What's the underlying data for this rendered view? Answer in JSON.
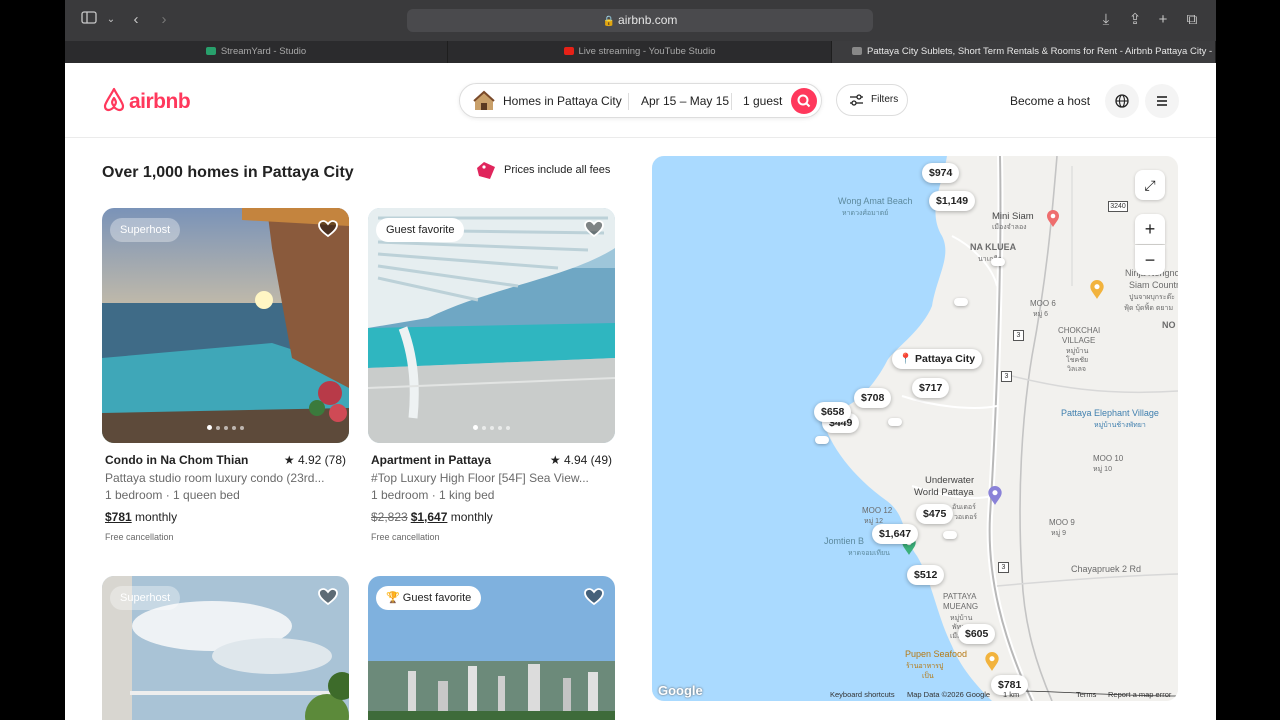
{
  "browser": {
    "url": "airbnb.com",
    "tabs": [
      {
        "label": "StreamYard - Studio",
        "active": false
      },
      {
        "label": "Live streaming - YouTube Studio",
        "active": false
      },
      {
        "label": "Pattaya City Sublets, Short Term Rentals & Rooms for Rent - Airbnb Pattaya City - C...",
        "active": true
      }
    ]
  },
  "header": {
    "logo": "airbnb",
    "search": {
      "location": "Homes in Pattaya City",
      "dates": "Apr 15 – May 15",
      "guests": "1 guest"
    },
    "filters_label": "Filters",
    "become_host": "Become a host"
  },
  "listings": {
    "title": "Over 1,000 homes in Pattaya City",
    "fees_note": "Prices include all fees",
    "cards": [
      {
        "badge": "Superhost",
        "title": "Condo in Na Chom Thian",
        "rating": "★ 4.92 (78)",
        "subtitle": "Pattaya studio room luxury condo (23rd...",
        "beds": "1 bedroom · 1 queen bed",
        "price": "$781",
        "price_unit": "monthly",
        "cancel": "Free cancellation"
      },
      {
        "badge": "Guest favorite",
        "title": "Apartment in Pattaya",
        "rating": "★ 4.94 (49)",
        "subtitle": "#Top Luxury High Floor [54F] Sea View...",
        "beds": "1 bedroom · 1 king bed",
        "old_price": "$2,823",
        "price": "$1,647",
        "price_unit": "monthly",
        "cancel": "Free cancellation"
      },
      {
        "badge": "Superhost"
      },
      {
        "badge": "Guest favorite",
        "badge_icon": "🏆"
      }
    ]
  },
  "map": {
    "pins": [
      "$974",
      "$1,149",
      "$717",
      "$708",
      "$658",
      "$449",
      "$475",
      "$1,647",
      "$512",
      "$605",
      "$781"
    ],
    "city_pin": "Pattaya City",
    "labels": {
      "wong_amat": "Wong Amat Beach",
      "wong_amat_th": "หาดวงศ์อมาตย์",
      "mini_siam": "Mini Siam",
      "mini_siam_th": "เมืองจำลอง",
      "na_klua": "NA KLUEA",
      "na_klua_th": "นาเกลือ",
      "nongnooch": "Ninja Nongnooch",
      "siam_country": "Siam Country",
      "siam_th": "ปูนจาผบุกระต๊ะ",
      "siam_th2": "ฟุ้ด บุ้ดฟิ้ด ตยาม",
      "no": "NO",
      "chokchai": "CHOKCHAI",
      "chokchai2": "VILLAGE",
      "chokchai_th": "หมู่บ้าน",
      "chokchai_th2": "โชคชัย",
      "chokchai_th3": "วิลเลจ",
      "moo6": "MOO 6",
      "moo6_th": "หมู่ 6",
      "elephant": "Pattaya Elephant Village",
      "elephant_th": "หมู่บ้านช้างพัทยา",
      "moo10": "MOO 10",
      "moo10_th": "หมู่ 10",
      "moo12": "MOO 12",
      "moo12_th": "หมู่ 12",
      "underwater": "Underwater",
      "underwater2": "World Pattaya",
      "underwater_th": "อันเดอร์",
      "underwater_th2": "วอเตอร์",
      "moo9": "MOO 9",
      "moo9_th": "หมู่ 9",
      "jomtien": "Jomtien B",
      "jomtien_th": "หาดจอมเทียน",
      "pattaya_muang": "PATTAYA",
      "pattaya_muang2": "MUEANG",
      "pattaya_muang_th": "หมู่บ้าน",
      "pattaya_muang_th2": "พัทยา",
      "pattaya_muang_th3": "เมืองใหม่",
      "chayapruek": "Chayapruek 2 Rd",
      "pupen": "Pupen Seafood",
      "pupen_th": "ร้านอาหารปู",
      "pupen_th2": "เป็น",
      "routes": [
        "3240",
        "3",
        "3",
        "3",
        "3"
      ]
    },
    "footer": {
      "shortcuts": "Keyboard shortcuts",
      "mapdata": "Map Data ©2026 Google",
      "scale": "1 km",
      "terms": "Terms",
      "report": "Report a map error"
    },
    "google": "Google"
  },
  "colors": {
    "brand": "#ff385c",
    "water": "#aadaff",
    "land": "#f2f1ee"
  }
}
